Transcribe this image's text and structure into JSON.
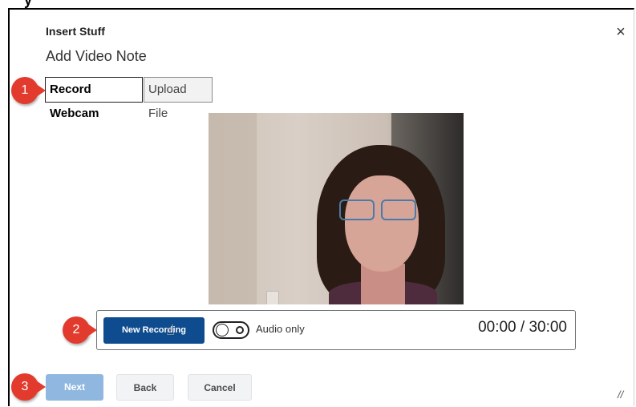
{
  "dialog": {
    "kicker": "Insert Stuff",
    "title": "Add Video Note",
    "close_glyph": "×"
  },
  "tabs": [
    {
      "label": "Record Webcam",
      "selected": true
    },
    {
      "label": "Upload File",
      "selected": false
    }
  ],
  "callouts": {
    "one": "1",
    "two": "2",
    "three": "3"
  },
  "recorder": {
    "new_recording_label": "New Recording",
    "audio_only_label": "Audio only",
    "audio_only_on": false,
    "timer": "00:00 / 30:00"
  },
  "footer": {
    "next_label": "Next",
    "back_label": "Back",
    "cancel_label": "Cancel"
  },
  "colors": {
    "primary": "#0e4b8f",
    "callout": "#e23b2e",
    "next_disabled": "#8fb7e0"
  }
}
